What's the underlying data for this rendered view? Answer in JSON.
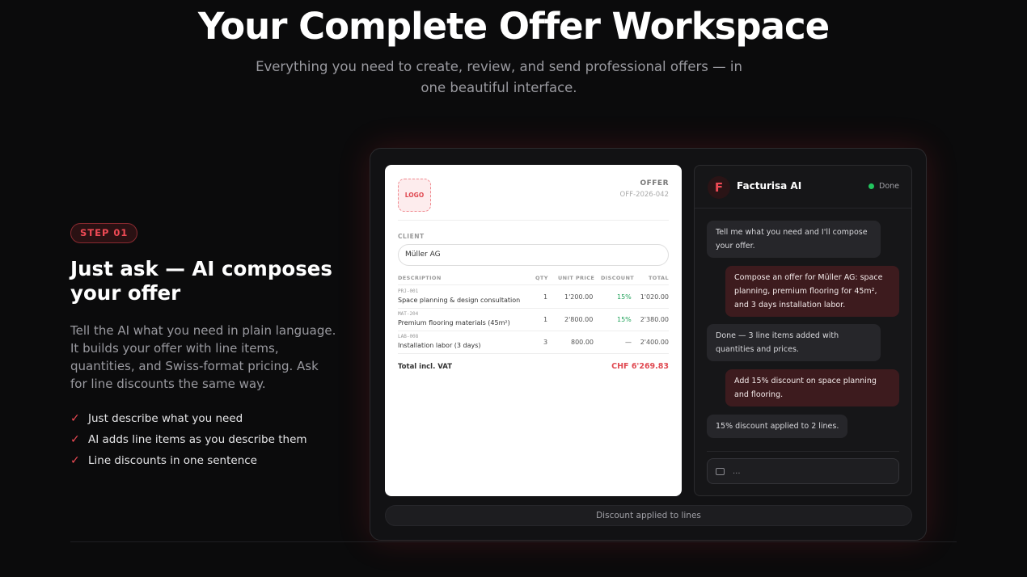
{
  "hero": {
    "title": "Your Complete Offer Workspace",
    "subtitle": "Everything you need to create, review, and send professional offers — in one beautiful interface."
  },
  "step": {
    "badge": "STEP 01",
    "title": "Just ask — AI composes your offer",
    "description": "Tell the AI what you need in plain language. It builds your offer with line items, quantities, and Swiss-format pricing. Ask for line discounts the same way.",
    "features": [
      "Just describe what you need",
      "AI adds line items as you describe them",
      "Line discounts in one sentence"
    ]
  },
  "offer": {
    "logo": "LOGO",
    "label": "OFFER",
    "number": "OFF-2026-042",
    "client_label": "CLIENT",
    "client_value": "Müller AG",
    "columns": {
      "description": "DESCRIPTION",
      "qty": "QTY",
      "unit_price": "UNIT PRICE",
      "discount": "DISCOUNT",
      "total": "TOTAL"
    },
    "rows": [
      {
        "code": "PRJ-001",
        "description": "Space planning & design consultation",
        "qty": "1",
        "unit_price": "1'200.00",
        "discount": "15%",
        "total": "1'020.00"
      },
      {
        "code": "MAT-204",
        "description": "Premium flooring materials (45m²)",
        "qty": "1",
        "unit_price": "2'800.00",
        "discount": "15%",
        "total": "2'380.00"
      },
      {
        "code": "LAB-008",
        "description": "Installation labor (3 days)",
        "qty": "3",
        "unit_price": "800.00",
        "discount": "—",
        "total": "2'400.00"
      }
    ],
    "total_label": "Total incl. VAT",
    "total_value": "CHF 6'269.83"
  },
  "chat": {
    "logo_letter": "F",
    "name": "Facturisa AI",
    "status": "Done",
    "status_color": "#22c55e",
    "messages": [
      {
        "role": "ai",
        "text": "Tell me what you need and I'll compose your offer."
      },
      {
        "role": "user",
        "text": "Compose an offer for Müller AG: space planning, premium flooring for 45m², and 3 days installation labor."
      },
      {
        "role": "ai",
        "text": "Done — 3 line items added with quantities and prices."
      },
      {
        "role": "user",
        "text": "Add 15% discount on space planning and flooring."
      },
      {
        "role": "ai",
        "text": "15% discount applied to 2 lines."
      }
    ],
    "input_placeholder": "..."
  },
  "status_bar": "Discount applied to lines",
  "colors": {
    "accent": "#ef4a55",
    "background": "#0b0b0c",
    "total": "#e04a52"
  }
}
